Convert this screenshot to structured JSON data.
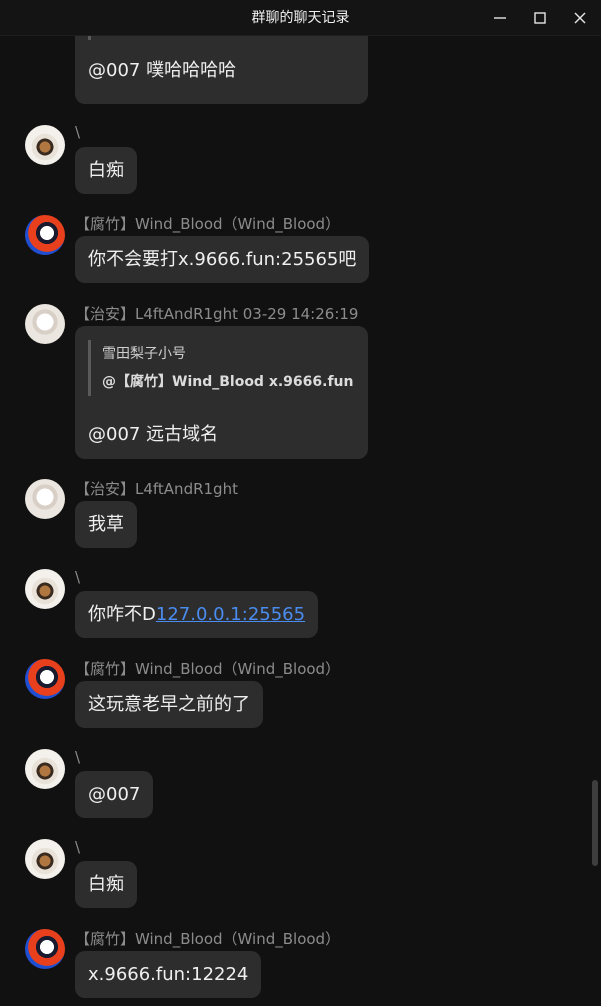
{
  "window": {
    "title": "群聊的聊天记录"
  },
  "messages": [
    {
      "reply_text": "@007 噗哈哈哈哈"
    },
    {
      "sender": "\\",
      "text": "白痴"
    },
    {
      "sender": "【腐竹】Wind_Blood（Wind_Blood）",
      "text": "你不会要打x.9666.fun:25565吧"
    },
    {
      "sender": "【治安】L4ftAndR1ght 03-29 14:26:19",
      "quote_author": "雪田梨子小号",
      "quote_text": "@【腐竹】Wind_Blood x.9666.fun",
      "reply_text": "@007 远古域名"
    },
    {
      "sender": "【治安】L4ftAndR1ght",
      "text": "我草"
    },
    {
      "sender": "\\",
      "text_prefix": "你咋不D",
      "link": "127.0.0.1:25565"
    },
    {
      "sender": "【腐竹】Wind_Blood（Wind_Blood）",
      "text": "这玩意老早之前的了"
    },
    {
      "sender": "\\",
      "text": "@007"
    },
    {
      "sender": "\\",
      "text": "白痴"
    },
    {
      "sender": "【腐竹】Wind_Blood（Wind_Blood）",
      "text": "x.9666.fun:12224"
    }
  ]
}
